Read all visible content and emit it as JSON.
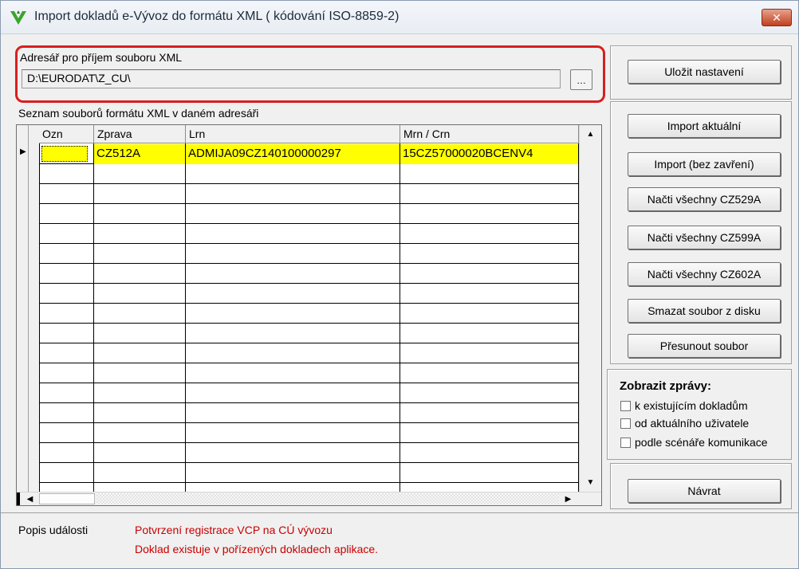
{
  "window": {
    "title": "Import dokladů e-Vývoz do formátu XML ( kódování ISO-8859-2)",
    "close_label": "✕"
  },
  "directory": {
    "label": "Adresář pro příjem souboru XML",
    "value": "D:\\EURODAT\\Z_CU\\",
    "browse_label": "…"
  },
  "buttons": {
    "save_settings": "Uložit nastavení",
    "import_current": "Import aktuální",
    "import_no_close": "Import (bez zavření)",
    "load_cz529a": "Načti všechny CZ529A",
    "load_cz599a": "Načti všechny CZ599A",
    "load_cz602a": "Načti všechny CZ602A",
    "delete_file": "Smazat soubor z disku",
    "move_file": "Přesunout soubor",
    "back": "Návrat"
  },
  "file_list": {
    "label": "Seznam souborů formátu XML v daném adresáři",
    "columns": [
      "Ozn",
      "Zprava",
      "Lrn",
      "Mrn / Crn"
    ],
    "rows": [
      [
        "",
        "CZ512A",
        "ADMIJA09CZ140100000297",
        "15CZ57000020BCENV4"
      ]
    ]
  },
  "show_messages": {
    "title": "Zobrazit zprávy:",
    "options": [
      {
        "label": "k existujícím dokladům",
        "checked": false
      },
      {
        "label": "od aktuálního uživatele",
        "checked": false
      },
      {
        "label": "podle scénáře komunikace",
        "checked": false
      }
    ]
  },
  "event": {
    "label": "Popis události",
    "lines": [
      "Potvrzení registrace VCP na CÚ vývozu",
      "Doklad existuje v pořízených dokladech aplikace."
    ]
  },
  "colors": {
    "highlight_row": "#ffff00",
    "event_text": "#c80000",
    "focus_frame": "#d81f1f"
  }
}
